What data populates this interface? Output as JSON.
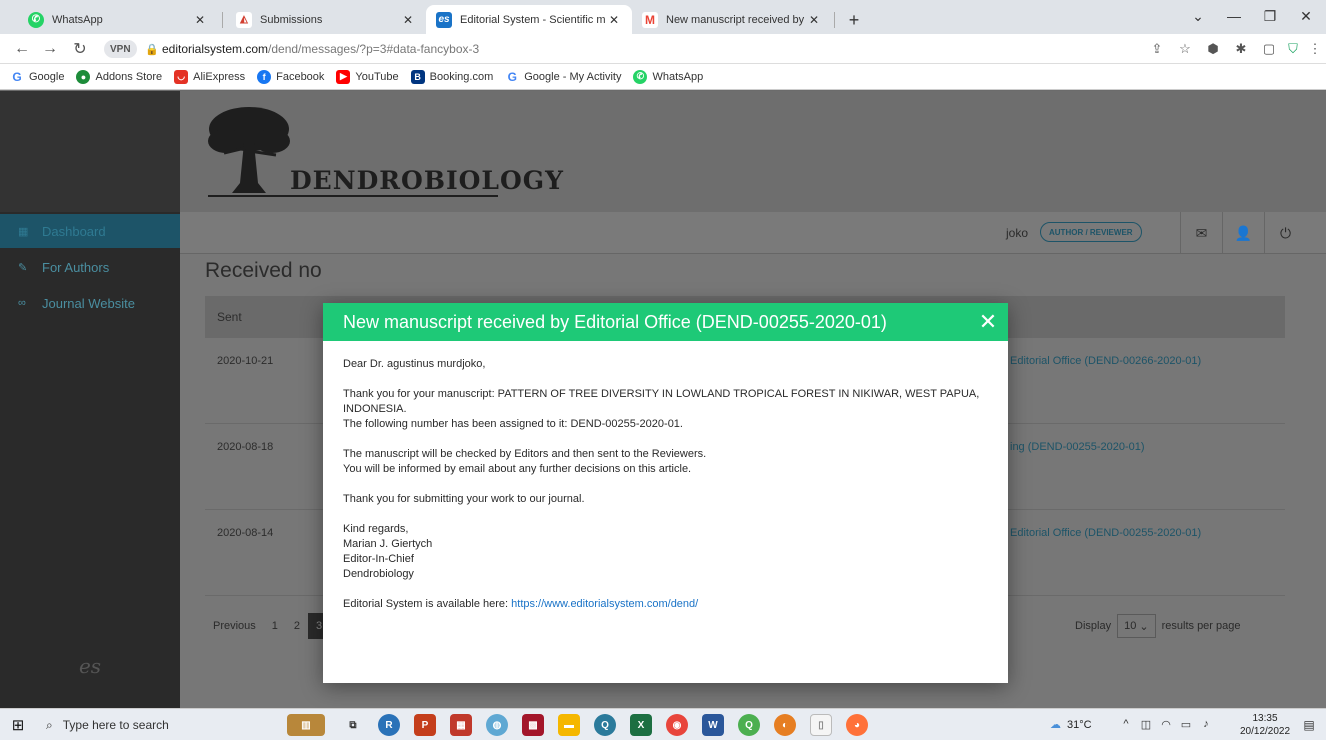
{
  "browser": {
    "tabs": [
      {
        "label": "WhatsApp",
        "icon": "whatsapp-icon",
        "color": "#25d366"
      },
      {
        "label": "Submissions",
        "icon": "submissions-icon",
        "color": "#d23f31"
      },
      {
        "label": "Editorial System - Scientific manu",
        "icon": "es-favicon",
        "color": "#1a73c7"
      },
      {
        "label": "New manuscript received by Edit",
        "icon": "gmail-icon",
        "color": "#ea4335"
      }
    ],
    "url_domain": "editorialsystem.com",
    "url_path": "/dend/messages/?p=3#data-fancybox-3",
    "vpn_label": "VPN",
    "bookmarks": [
      {
        "label": "Google",
        "icon": "google-icon",
        "color": "#4285f4"
      },
      {
        "label": "Addons Store",
        "icon": "addons-store-icon",
        "color": "#1d8c3a"
      },
      {
        "label": "AliExpress",
        "icon": "aliexpress-icon",
        "color": "#e43225"
      },
      {
        "label": "Facebook",
        "icon": "facebook-icon",
        "color": "#1877f2"
      },
      {
        "label": "YouTube",
        "icon": "youtube-icon",
        "color": "#ff0000"
      },
      {
        "label": "Booking.com",
        "icon": "booking-icon",
        "color": "#003580"
      },
      {
        "label": "Google - My Activity",
        "icon": "google-icon",
        "color": "#4285f4"
      },
      {
        "label": "WhatsApp",
        "icon": "whatsapp-icon",
        "color": "#25d366"
      }
    ]
  },
  "site": {
    "logo_text": "DENDROBIOLOGY",
    "sidebar": [
      {
        "label": "Dashboard",
        "icon": "grid-icon",
        "active": true
      },
      {
        "label": "For Authors",
        "icon": "pencil-icon",
        "active": false
      },
      {
        "label": "Journal Website",
        "icon": "link-icon",
        "active": false
      }
    ],
    "sidebar_logo": "es",
    "user_name_fragment": "joko",
    "user_role": "AUTHOR / REVIEWER",
    "page_title": "Received no",
    "table": {
      "header_sent": "Sent",
      "rows": [
        {
          "date": "2020-10-21",
          "subject": "Editorial Office (DEND-00266-2020-01)"
        },
        {
          "date": "2020-08-18",
          "subject": "ing (DEND-00255-2020-01)"
        },
        {
          "date": "2020-08-14",
          "subject": "Editorial Office (DEND-00255-2020-01)"
        }
      ]
    },
    "pager": {
      "prev": "Previous",
      "pages": [
        "1",
        "2",
        "3"
      ],
      "current": "3"
    },
    "display": {
      "before": "Display",
      "value": "10",
      "after": "results per page"
    }
  },
  "modal": {
    "title": "New manuscript received by Editorial Office (DEND-00255-2020-01)",
    "greeting": "Dear Dr. agustinus murdjoko,",
    "p1_line1": "Thank you for your manuscript: PATTERN OF TREE DIVERSITY IN LOWLAND TROPICAL FOREST IN NIKIWAR, WEST PAPUA, INDONESIA.",
    "p1_line2": "The following number has been assigned to it: DEND-00255-2020-01.",
    "p2_line1": "The manuscript will be checked by Editors and then sent to the Reviewers.",
    "p2_line2": "You will be informed by email about any further decisions on this article.",
    "p3": "Thank you for submitting your work to our journal.",
    "sig1": "Kind regards,",
    "sig2": "Marian J. Giertych",
    "sig3": "Editor-In-Chief",
    "sig4": "Dendrobiology",
    "footer_text": "Editorial System is available here: ",
    "footer_link": "https://www.editorialsystem.com/dend/",
    "header_color": "#1ec977"
  },
  "taskbar": {
    "search_placeholder": "Type here to search",
    "weather": "31°C",
    "time": "13:35",
    "date": "20/12/2022"
  }
}
